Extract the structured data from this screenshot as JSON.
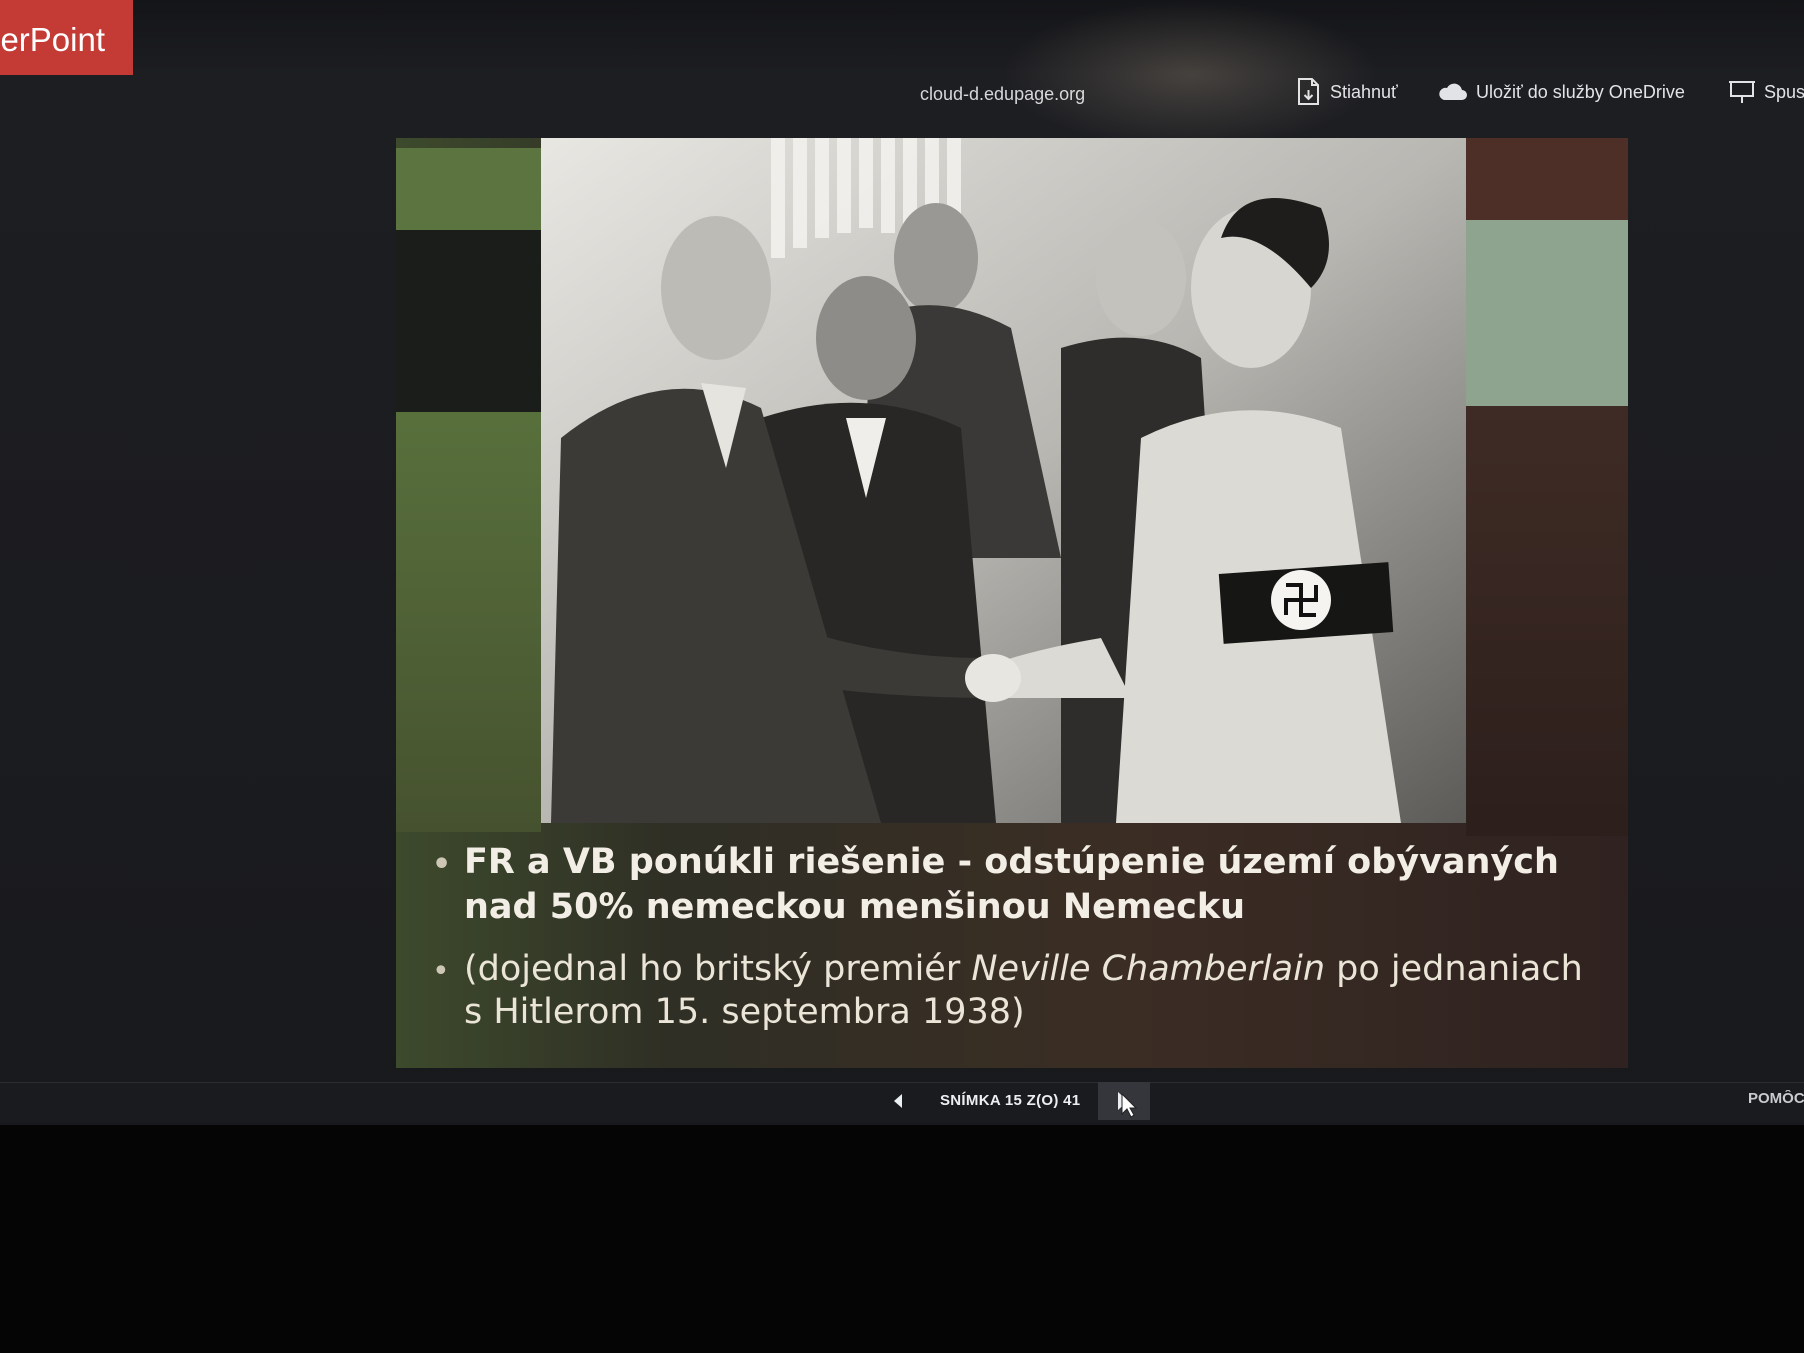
{
  "app": {
    "badge_text": "erPoint",
    "badge_color": "#c43a35"
  },
  "header": {
    "document_title": "cloud-d.edupage.org"
  },
  "commands": [
    {
      "label": "Stiahnuť",
      "icon": "download-icon"
    },
    {
      "label": "Uložiť do služby OneDrive",
      "icon": "onedrive-cloud-icon"
    },
    {
      "label": "Spus",
      "icon": "present-icon"
    }
  ],
  "slide": {
    "bullets": [
      {
        "text": "FR a VB ponúkli riešenie - odstúpenie území obývaných nad 50% nemeckou menšinou Nemecku"
      },
      {
        "text_before": "(dojednal ho britský premiér ",
        "text_italic": "Neville Chamberlain",
        "text_after": " po jednaniach s Hitlerom 15. septembra 1938)"
      }
    ],
    "photo": {
      "description_icon": "historical-photo"
    }
  },
  "statusbar": {
    "slide_counter": "SNÍMKA 15 Z(O) 41",
    "help_label": "POMÔC"
  },
  "colors": {
    "band_green": "#5b7440",
    "band_light_green": "#8fa48f",
    "band_brown": "#4d2f27",
    "band_dark": "#1b1d1b"
  }
}
